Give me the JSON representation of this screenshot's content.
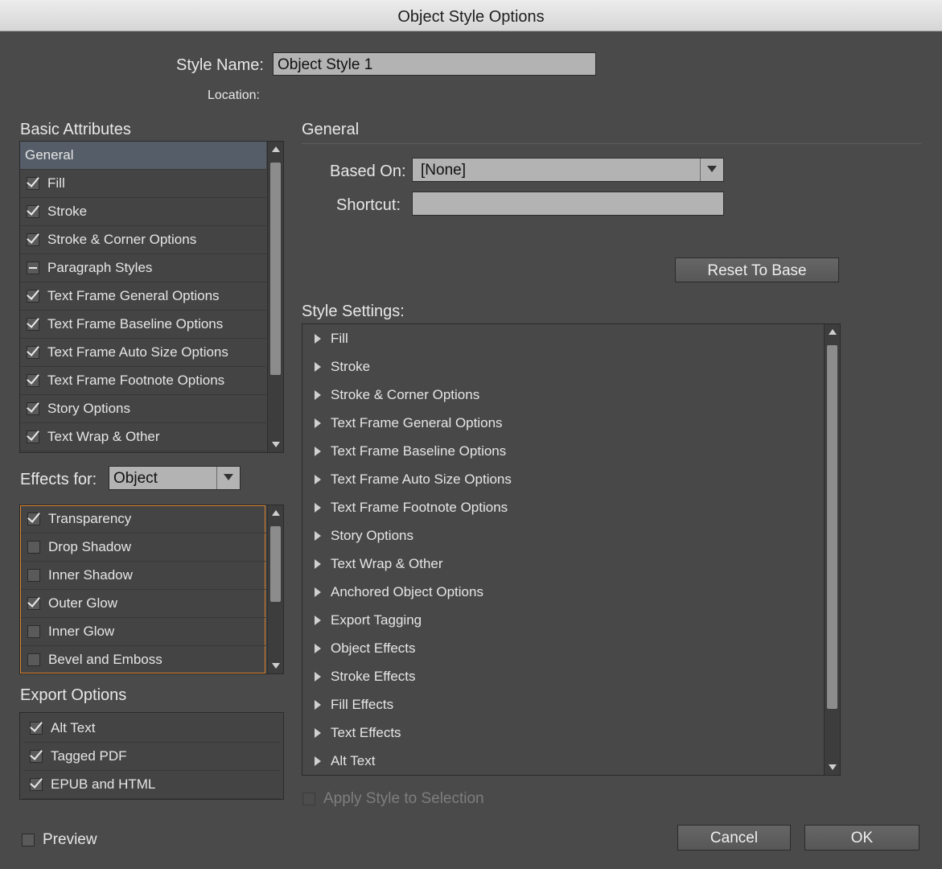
{
  "window": {
    "title": "Object Style Options"
  },
  "header": {
    "style_name_label": "Style Name:",
    "style_name_value": "Object Style 1",
    "location_label": "Location:"
  },
  "basic": {
    "title": "Basic Attributes",
    "items": [
      {
        "label": "General",
        "state": "none",
        "selected": true
      },
      {
        "label": "Fill",
        "state": "checked"
      },
      {
        "label": "Stroke",
        "state": "checked"
      },
      {
        "label": "Stroke & Corner Options",
        "state": "checked"
      },
      {
        "label": "Paragraph Styles",
        "state": "mixed"
      },
      {
        "label": "Text Frame General Options",
        "state": "checked"
      },
      {
        "label": "Text Frame Baseline Options",
        "state": "checked"
      },
      {
        "label": "Text Frame Auto Size Options",
        "state": "checked"
      },
      {
        "label": "Text Frame Footnote Options",
        "state": "checked"
      },
      {
        "label": "Story Options",
        "state": "checked"
      },
      {
        "label": "Text Wrap & Other",
        "state": "checked"
      }
    ]
  },
  "effects": {
    "label": "Effects for:",
    "value": "Object",
    "items": [
      {
        "label": "Transparency",
        "state": "checked"
      },
      {
        "label": "Drop Shadow",
        "state": "unchecked"
      },
      {
        "label": "Inner Shadow",
        "state": "unchecked"
      },
      {
        "label": "Outer Glow",
        "state": "checked"
      },
      {
        "label": "Inner Glow",
        "state": "unchecked"
      },
      {
        "label": "Bevel and Emboss",
        "state": "unchecked"
      }
    ]
  },
  "export": {
    "title": "Export Options",
    "items": [
      {
        "label": "Alt Text",
        "state": "checked"
      },
      {
        "label": "Tagged PDF",
        "state": "checked"
      },
      {
        "label": "EPUB and HTML",
        "state": "checked"
      }
    ]
  },
  "general": {
    "title": "General",
    "based_on_label": "Based On:",
    "based_on_value": "[None]",
    "shortcut_label": "Shortcut:",
    "shortcut_value": "",
    "reset_label": "Reset To Base"
  },
  "settings": {
    "title": "Style Settings:",
    "items": [
      "Fill",
      "Stroke",
      "Stroke & Corner Options",
      "Text Frame General Options",
      "Text Frame Baseline Options",
      "Text Frame Auto Size Options",
      "Text Frame Footnote Options",
      "Story Options",
      "Text Wrap & Other",
      "Anchored Object Options",
      "Export Tagging",
      "Object Effects",
      "Stroke Effects",
      "Fill Effects",
      "Text Effects",
      "Alt Text"
    ]
  },
  "footer": {
    "apply_label": "Apply Style to Selection",
    "preview_label": "Preview",
    "cancel_label": "Cancel",
    "ok_label": "OK"
  },
  "colors": {
    "dialog_bg": "#4a4a4a",
    "selected_row": "#555d68",
    "focus_border": "#d9822b"
  }
}
